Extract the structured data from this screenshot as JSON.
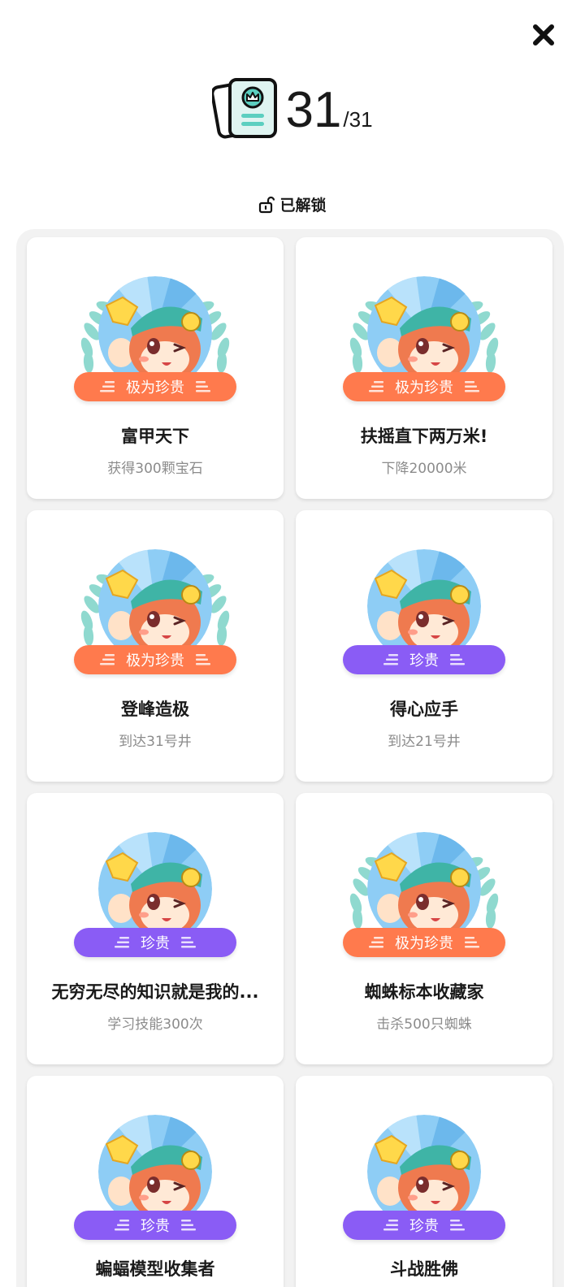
{
  "header": {
    "count": "31",
    "total": "/31"
  },
  "section": {
    "unlocked_label": "已解锁"
  },
  "colors": {
    "orange_badge": "#ff7a4d",
    "purple_badge": "#8a5cf5",
    "panel_bg": "#f2f2f2"
  },
  "achievements": [
    {
      "rarity": "极为珍贵",
      "rarity_color": "orange",
      "laurel": true,
      "title": "富甲天下",
      "desc": "获得300颗宝石"
    },
    {
      "rarity": "极为珍贵",
      "rarity_color": "orange",
      "laurel": true,
      "title": "扶摇直下两万米!",
      "desc": "下降20000米"
    },
    {
      "rarity": "极为珍贵",
      "rarity_color": "orange",
      "laurel": true,
      "title": "登峰造极",
      "desc": "到达31号井"
    },
    {
      "rarity": "珍贵",
      "rarity_color": "purple",
      "laurel": false,
      "title": "得心应手",
      "desc": "到达21号井"
    },
    {
      "rarity": "珍贵",
      "rarity_color": "purple",
      "laurel": false,
      "title": "无穷无尽的知识就是我的...",
      "desc": "学习技能300次"
    },
    {
      "rarity": "极为珍贵",
      "rarity_color": "orange",
      "laurel": true,
      "title": "蜘蛛标本收藏家",
      "desc": "击杀500只蜘蛛"
    },
    {
      "rarity": "珍贵",
      "rarity_color": "purple",
      "laurel": false,
      "title": "蝙蝠模型收集者",
      "desc": ""
    },
    {
      "rarity": "珍贵",
      "rarity_color": "purple",
      "laurel": false,
      "title": "斗战胜佛",
      "desc": ""
    }
  ]
}
